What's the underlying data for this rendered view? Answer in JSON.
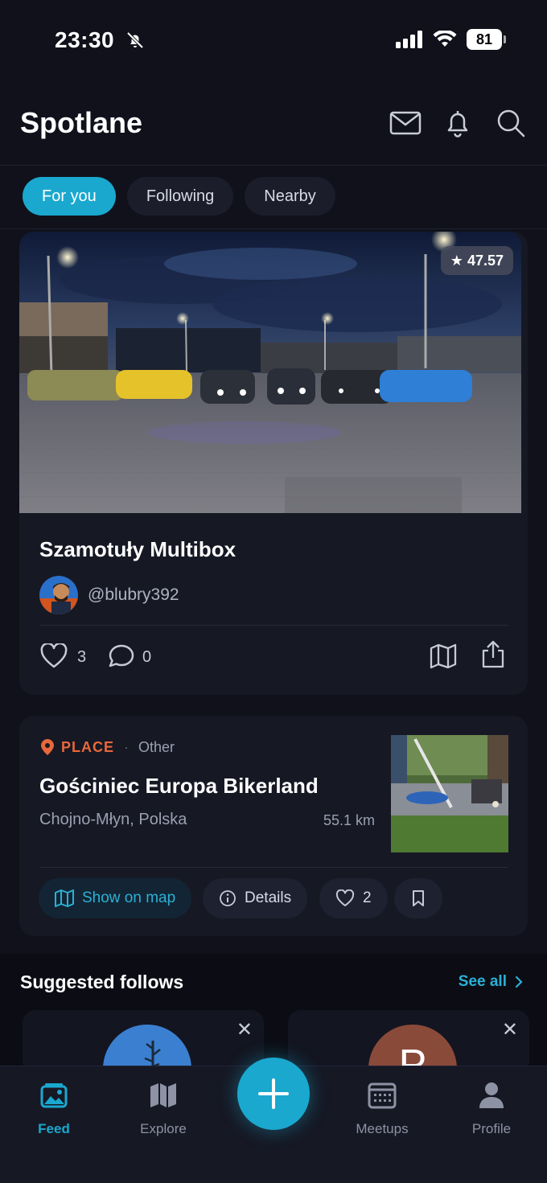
{
  "status_bar": {
    "time": "23:30",
    "battery": "81"
  },
  "header": {
    "title": "Spotlane"
  },
  "tabs": [
    {
      "label": "For you",
      "active": true
    },
    {
      "label": "Following",
      "active": false
    },
    {
      "label": "Nearby",
      "active": false
    }
  ],
  "post": {
    "rating": "47.57",
    "title": "Szamotuły Multibox",
    "username": "@blubry392",
    "likes": "3",
    "comments": "0"
  },
  "place": {
    "type": "PLACE",
    "category": "Other",
    "name": "Gościniec Europa Bikerland",
    "location": "Chojno-Młyn, Polska",
    "distance": "55.1 km",
    "show_on_map_label": "Show on map",
    "details_label": "Details",
    "likes": "2"
  },
  "suggested": {
    "title": "Suggested follows",
    "see_all": "See all",
    "cards": [
      {
        "avatar_letter": ""
      },
      {
        "avatar_letter": "P"
      }
    ]
  },
  "bottom_nav": {
    "items": [
      {
        "label": "Feed",
        "icon": "image-icon",
        "active": true
      },
      {
        "label": "Explore",
        "icon": "map-icon",
        "active": false
      },
      {
        "label": "Meetups",
        "icon": "calendar-icon",
        "active": false
      },
      {
        "label": "Profile",
        "icon": "person-icon",
        "active": false
      }
    ]
  },
  "colors": {
    "accent": "#1aa8cf",
    "background": "#10111a",
    "card": "#161824",
    "place_orange": "#e8683a"
  }
}
